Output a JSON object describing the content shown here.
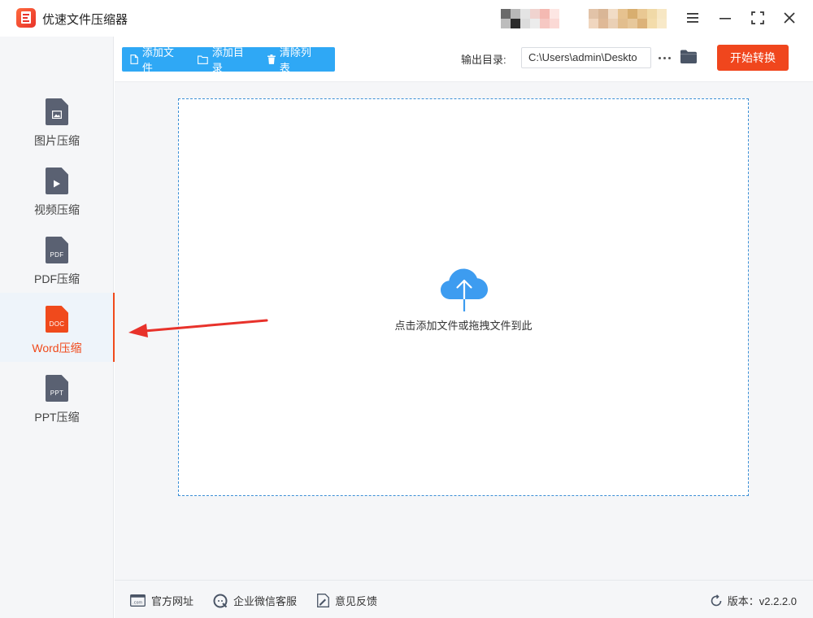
{
  "app": {
    "title": "优速文件压缩器"
  },
  "window_controls": [
    "menu-icon",
    "minimize-icon",
    "maximize-icon",
    "close-icon"
  ],
  "sidebar": {
    "items": [
      {
        "label": "图片压缩",
        "icon": "image-file-icon",
        "tag": "",
        "active": false
      },
      {
        "label": "视频压缩",
        "icon": "video-file-icon",
        "tag": "",
        "active": false
      },
      {
        "label": "PDF压缩",
        "icon": "pdf-file-icon",
        "tag": "PDF",
        "active": false
      },
      {
        "label": "Word压缩",
        "icon": "doc-file-icon",
        "tag": "DOC",
        "active": true
      },
      {
        "label": "PPT压缩",
        "icon": "ppt-file-icon",
        "tag": "PPT",
        "active": false
      }
    ]
  },
  "toolbar": {
    "add_file": "添加文件",
    "add_folder": "添加目录",
    "clear_list": "清除列表",
    "output_label": "输出目录:",
    "output_path": "C:\\Users\\admin\\Deskto",
    "start": "开始转换"
  },
  "dropzone": {
    "text": "点击添加文件或拖拽文件到此"
  },
  "footer": {
    "website": "官方网址",
    "wechat": "企业微信客服",
    "feedback": "意见反馈",
    "version": "版本：v2.2.2.0"
  },
  "colors": {
    "accent": "#f0461d",
    "toolbar_blue": "#2fa8f5",
    "sidebar_bg": "#f5f6f8",
    "cloud_blue": "#3d9cf0"
  }
}
